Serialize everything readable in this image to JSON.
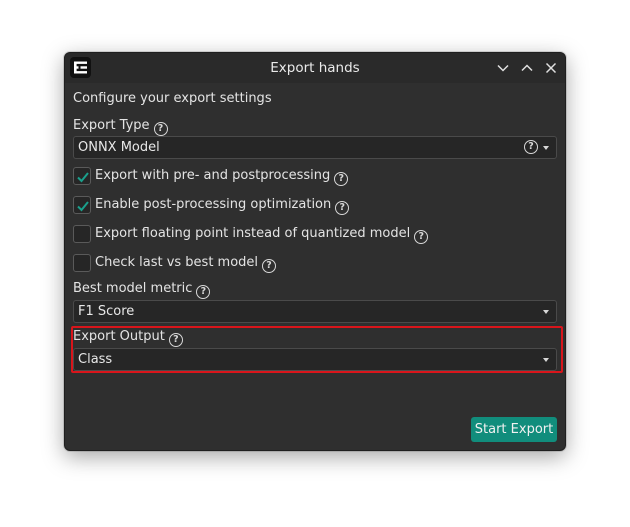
{
  "window": {
    "title": "Export hands",
    "icon": "app-logo-icon",
    "controls": [
      "minimize-icon",
      "maximize-icon",
      "close-icon"
    ]
  },
  "intro": "Configure your export settings",
  "export_type": {
    "label": "Export Type",
    "value": "ONNX Model"
  },
  "checkboxes": [
    {
      "label": "Export with pre- and postprocessing",
      "checked": true
    },
    {
      "label": "Enable post-processing optimization",
      "checked": true
    },
    {
      "label": "Export floating point instead of quantized model",
      "checked": false
    },
    {
      "label": "Check last vs best model",
      "checked": false
    }
  ],
  "best_model_metric": {
    "label": "Best model metric",
    "value": "F1 Score"
  },
  "export_output": {
    "label": "Export Output",
    "value": "Class"
  },
  "start_export_label": "Start Export",
  "colors": {
    "accent": "#118d7c",
    "highlight": "#d9151b",
    "check": "#1aa08c"
  }
}
